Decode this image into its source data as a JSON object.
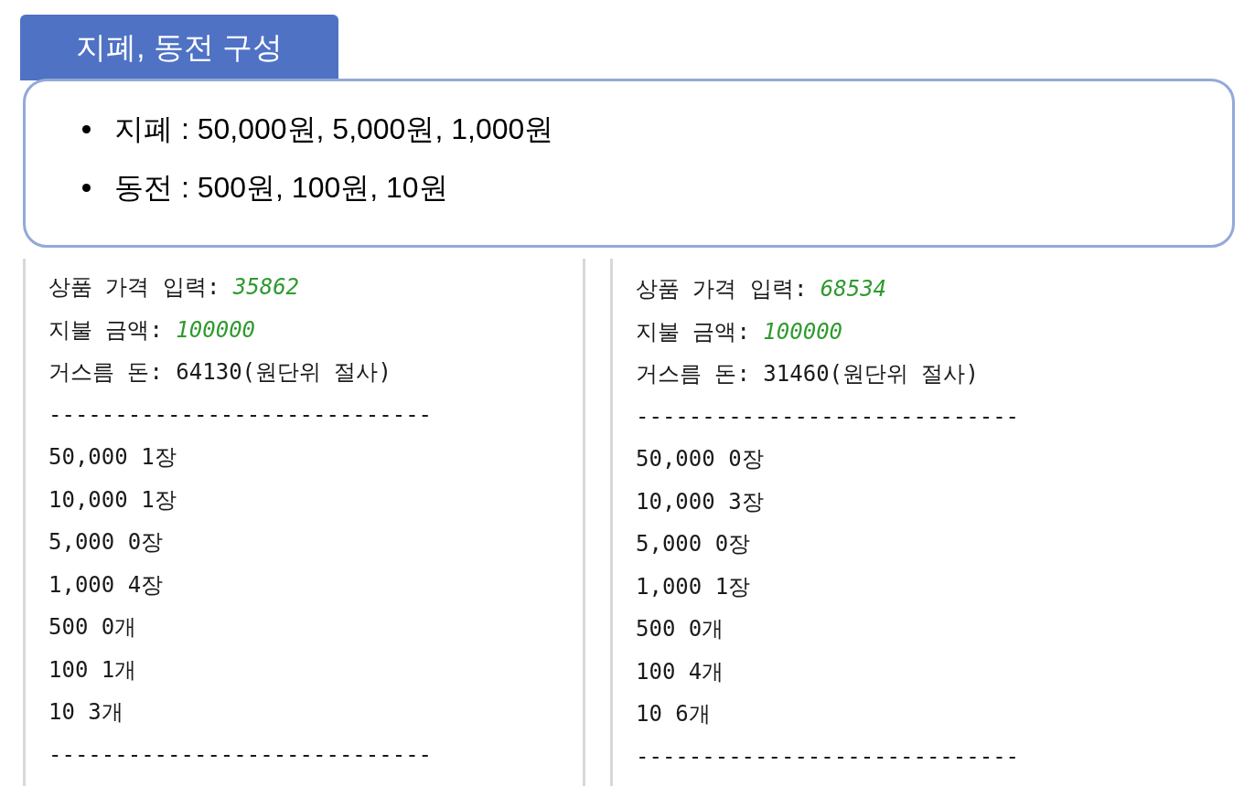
{
  "header": {
    "title": "지폐, 동전 구성"
  },
  "bullets": [
    "지폐 : 50,000원, 5,000원, 1,000원",
    "동전 : 500원, 100원, 10원"
  ],
  "consoles": [
    {
      "lines": [
        {
          "kind": "input",
          "label": "상품 가격 입력: ",
          "value": "35862"
        },
        {
          "kind": "input",
          "label": "지불 금액: ",
          "value": "100000"
        },
        {
          "kind": "text",
          "text": "거스름 돈: 64130(원단위 절사)"
        },
        {
          "kind": "text",
          "text": "-----------------------------"
        },
        {
          "kind": "text",
          "text": "50,000 1장"
        },
        {
          "kind": "text",
          "text": "10,000 1장"
        },
        {
          "kind": "text",
          "text": "5,000 0장"
        },
        {
          "kind": "text",
          "text": "1,000 4장"
        },
        {
          "kind": "text",
          "text": "500 0개"
        },
        {
          "kind": "text",
          "text": "100 1개"
        },
        {
          "kind": "text",
          "text": "10 3개"
        },
        {
          "kind": "text",
          "text": "-----------------------------"
        }
      ]
    },
    {
      "lines": [
        {
          "kind": "input",
          "label": "상품 가격 입력: ",
          "value": "68534"
        },
        {
          "kind": "input",
          "label": "지불 금액: ",
          "value": "100000"
        },
        {
          "kind": "text",
          "text": "거스름 돈: 31460(원단위 절사)"
        },
        {
          "kind": "text",
          "text": "-----------------------------"
        },
        {
          "kind": "text",
          "text": "50,000 0장"
        },
        {
          "kind": "text",
          "text": "10,000 3장"
        },
        {
          "kind": "text",
          "text": "5,000 0장"
        },
        {
          "kind": "text",
          "text": "1,000 1장"
        },
        {
          "kind": "text",
          "text": "500 0개"
        },
        {
          "kind": "text",
          "text": "100 4개"
        },
        {
          "kind": "text",
          "text": "10 6개"
        },
        {
          "kind": "text",
          "text": "-----------------------------"
        }
      ]
    }
  ]
}
